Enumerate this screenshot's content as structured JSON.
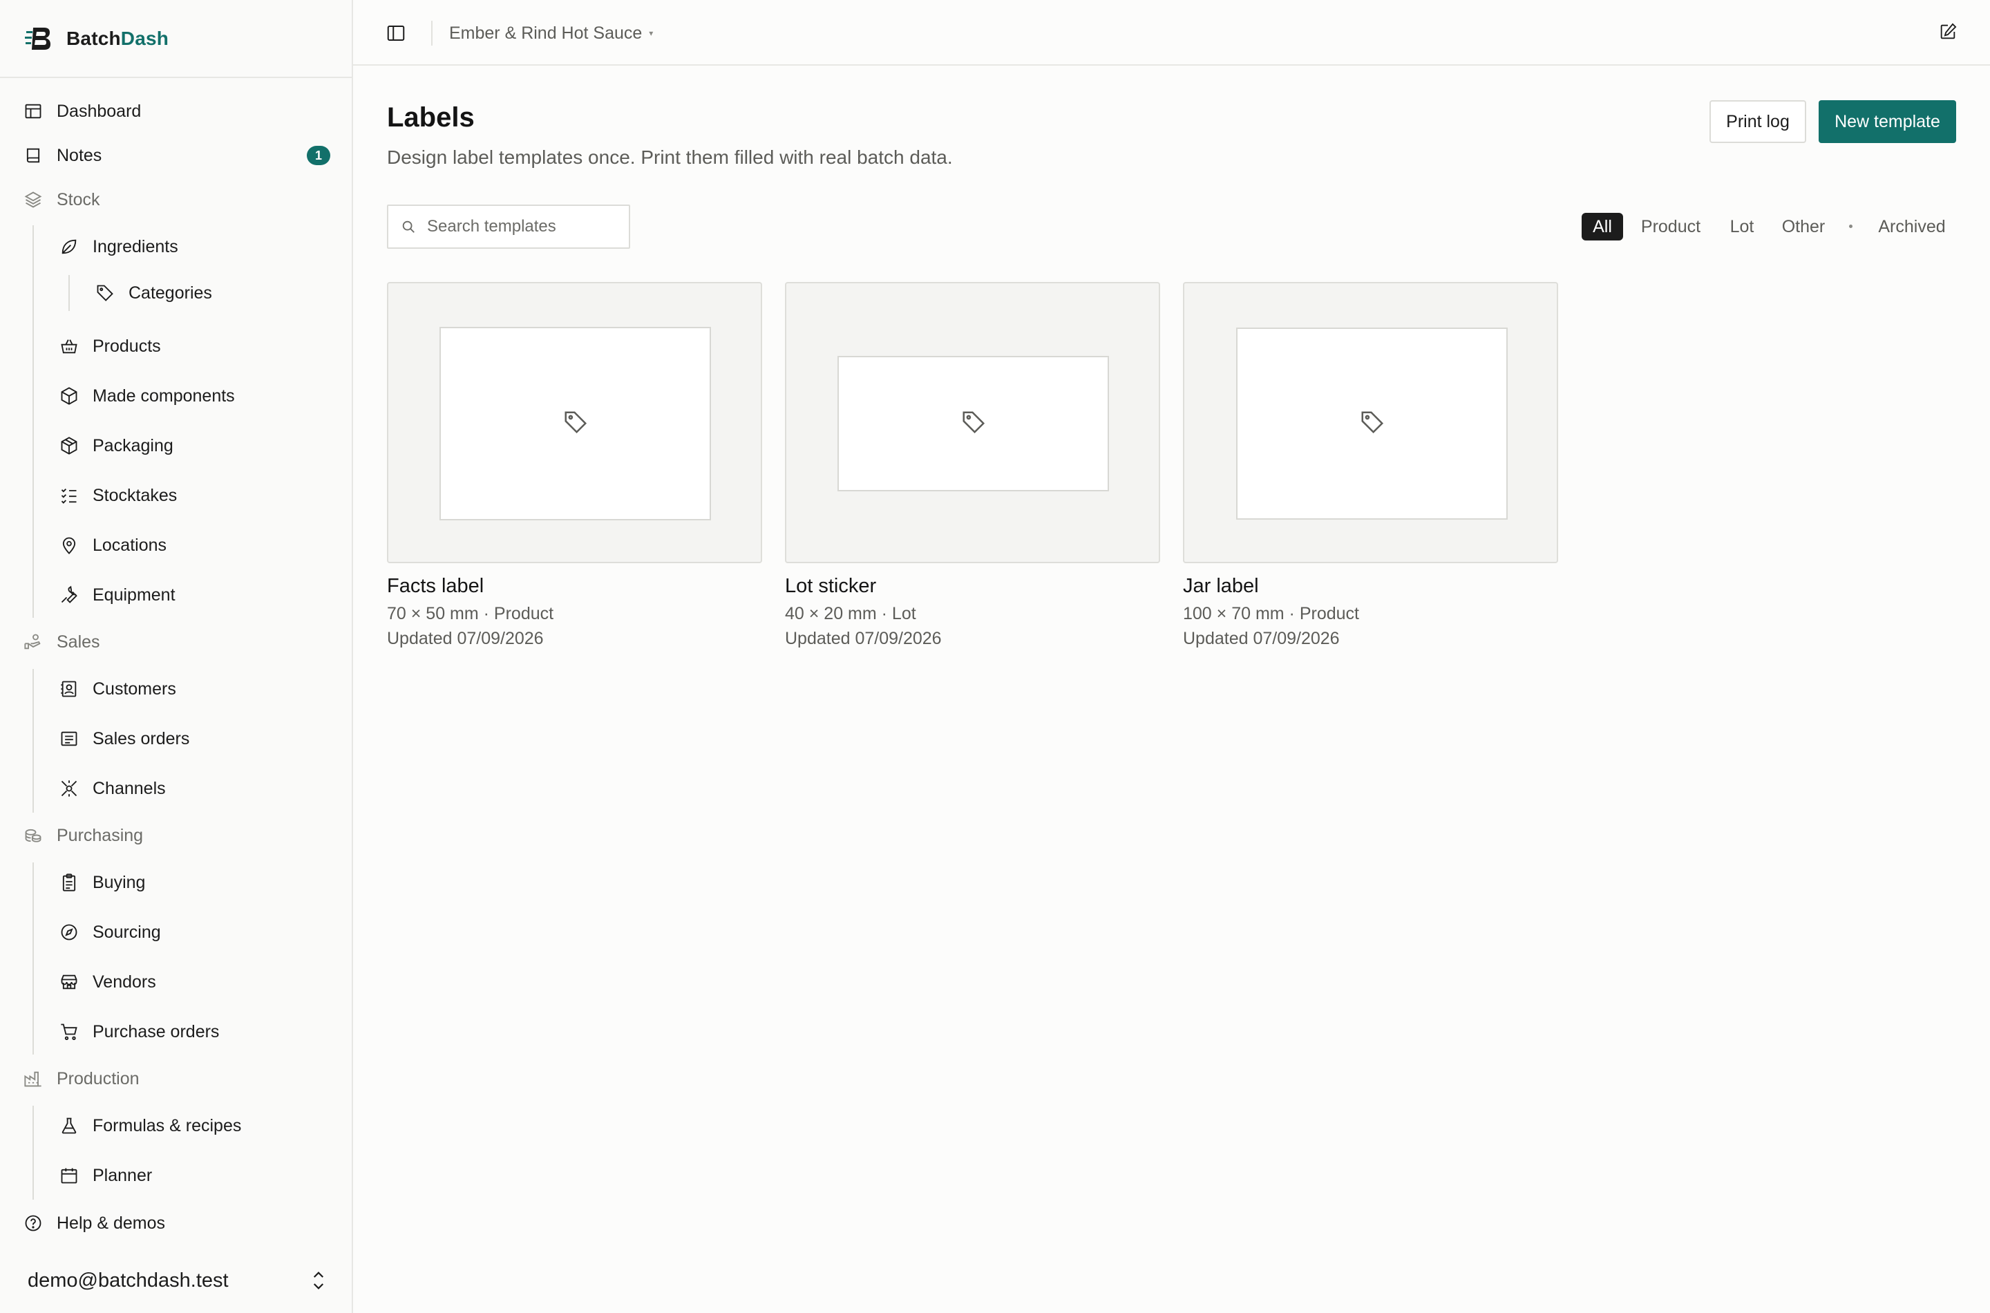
{
  "app": {
    "brand_prefix": "Batch",
    "brand_suffix": "Dash",
    "accent_color": "#12706a"
  },
  "topbar": {
    "workspace": "Ember & Rind Hot Sauce",
    "caret": "▾"
  },
  "sidebar": {
    "items": [
      {
        "label": "Dashboard",
        "icon": "dashboard-icon"
      },
      {
        "label": "Notes",
        "icon": "notes-icon",
        "badge": "1"
      },
      {
        "label": "Stock",
        "icon": "layers-icon"
      },
      {
        "label": "Ingredients",
        "icon": "leaf-icon"
      },
      {
        "label": "Categories",
        "icon": "tag-icon"
      },
      {
        "label": "Products",
        "icon": "basket-icon"
      },
      {
        "label": "Made components",
        "icon": "cube-icon"
      },
      {
        "label": "Packaging",
        "icon": "package-icon"
      },
      {
        "label": "Stocktakes",
        "icon": "checklist-icon"
      },
      {
        "label": "Locations",
        "icon": "map-pin-icon"
      },
      {
        "label": "Equipment",
        "icon": "wrench-icon"
      },
      {
        "label": "Sales",
        "icon": "hand-coins-icon"
      },
      {
        "label": "Customers",
        "icon": "contact-icon"
      },
      {
        "label": "Sales orders",
        "icon": "receipt-icon"
      },
      {
        "label": "Channels",
        "icon": "satellite-icon"
      },
      {
        "label": "Purchasing",
        "icon": "coins-icon"
      },
      {
        "label": "Buying",
        "icon": "clipboard-icon"
      },
      {
        "label": "Sourcing",
        "icon": "compass-icon"
      },
      {
        "label": "Vendors",
        "icon": "store-icon"
      },
      {
        "label": "Purchase orders",
        "icon": "cart-icon"
      },
      {
        "label": "Production",
        "icon": "factory-icon"
      },
      {
        "label": "Formulas & recipes",
        "icon": "flask-icon"
      },
      {
        "label": "Planner",
        "icon": "calendar-icon"
      },
      {
        "label": "Help & demos",
        "icon": "help-icon"
      }
    ],
    "account": "demo@batchdash.test"
  },
  "main": {
    "title": "Labels",
    "subtitle": "Design label templates once. Print them filled with real batch data.",
    "print_log_label": "Print log",
    "new_template_label": "New template",
    "search_placeholder": "Search templates",
    "filters": [
      "All",
      "Product",
      "Lot",
      "Other",
      "Archived"
    ],
    "active_filter": "All",
    "templates": [
      {
        "name": "Facts label",
        "meta": "70 × 50 mm · Product",
        "updated": "Updated 07/09/2026"
      },
      {
        "name": "Lot sticker",
        "meta": "40 × 20 mm · Lot",
        "updated": "Updated 07/09/2026"
      },
      {
        "name": "Jar label",
        "meta": "100 × 70 mm · Product",
        "updated": "Updated 07/09/2026"
      }
    ]
  }
}
